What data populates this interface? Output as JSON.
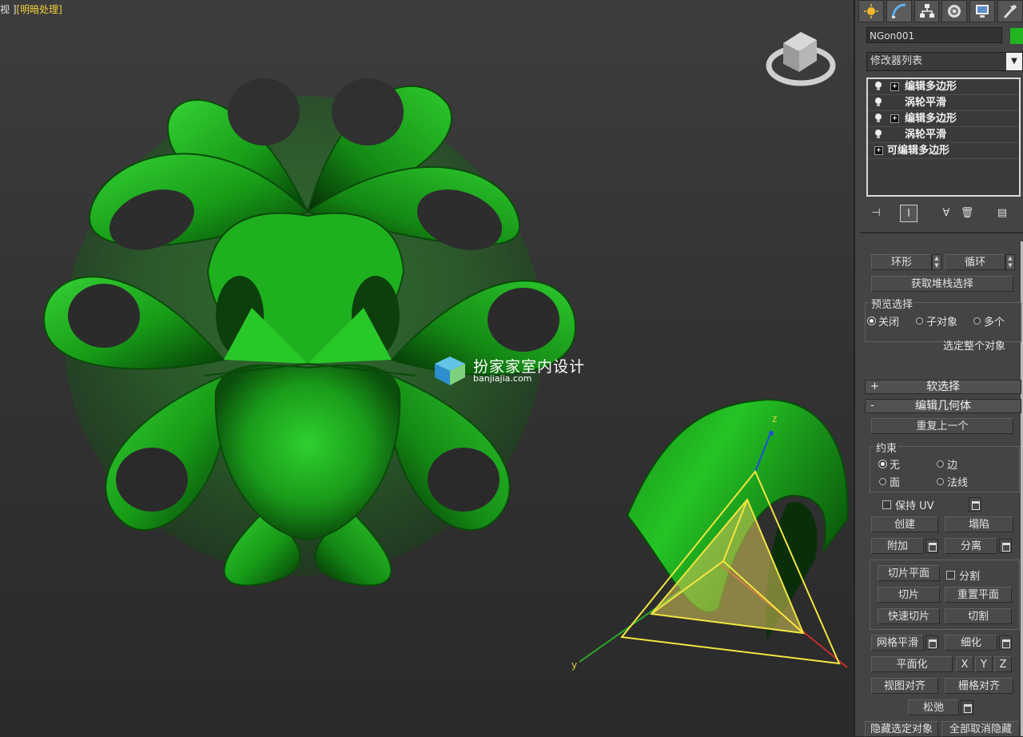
{
  "viewport": {
    "label_prefix": "视 ]",
    "label_mode": "[明暗处理]"
  },
  "watermark": {
    "title": "扮家家室内设计",
    "url": "banjiajia.com"
  },
  "gizmo": {
    "axis_z": "z",
    "axis_y": "y"
  },
  "panel": {
    "tabs": [
      "create-icon",
      "modify-icon",
      "hierarchy-icon",
      "motion-icon",
      "display-icon",
      "utilities-icon"
    ],
    "object_name": "NGon001",
    "object_color": "#21b521",
    "modifier_list": "修改器列表",
    "stack": [
      "编辑多边形",
      "涡轮平滑",
      "编辑多边形",
      "涡轮平滑",
      "可编辑多边形"
    ],
    "ring_label": "环形",
    "loop_label": "循环",
    "get_stack_sel": "获取堆栈选择",
    "preview_title": "预览选择",
    "preview_off": "关闭",
    "preview_sub": "子对象",
    "preview_multi": "多个",
    "select_whole": "选定整个对象",
    "soft_sel": "软选择",
    "edit_geom": "编辑几何体",
    "repeat_last": "重复上一个",
    "constraint_title": "约束",
    "c_none": "无",
    "c_edge": "边",
    "c_face": "面",
    "c_normal": "法线",
    "keep_uv": "保持 UV",
    "create": "创建",
    "collapse": "塌陷",
    "attach": "附加",
    "detach": "分离",
    "slice_plane": "切片平面",
    "split": "分割",
    "slice": "切片",
    "reset_plane": "重置平面",
    "quick_slice": "快速切片",
    "cut": "切割",
    "meshsmooth": "网格平滑",
    "tessellate": "细化",
    "make_planar": "平面化",
    "x": "X",
    "y": "Y",
    "z": "Z",
    "view_align": "视图对齐",
    "grid_align": "栅格对齐",
    "relax": "松弛",
    "hide_selected": "隐藏选定对象",
    "unhide_all": "全部取消隐藏"
  }
}
